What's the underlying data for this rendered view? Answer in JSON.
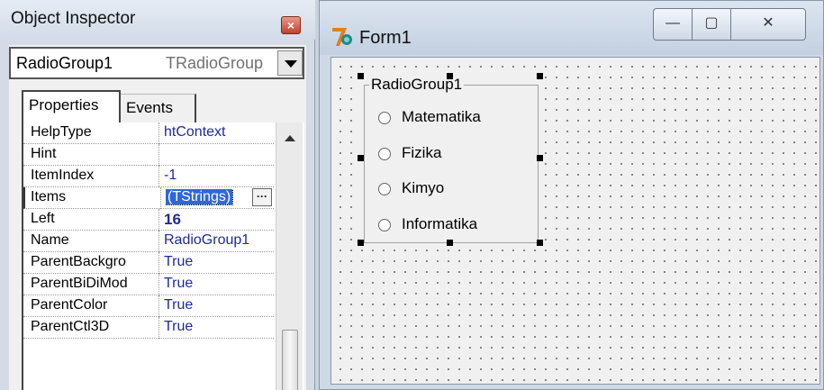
{
  "inspector": {
    "title": "Object Inspector",
    "close_glyph": "×",
    "selected_component": "RadioGroup1",
    "selected_type": "TRadioGroup",
    "tabs": {
      "properties": "Properties",
      "events": "Events"
    },
    "properties": [
      {
        "name": "HelpType",
        "value": "htContext"
      },
      {
        "name": "Hint",
        "value": ""
      },
      {
        "name": "ItemIndex",
        "value": "-1"
      },
      {
        "name": "Items",
        "value": "(TStrings)"
      },
      {
        "name": "Left",
        "value": "16"
      },
      {
        "name": "Name",
        "value": "RadioGroup1"
      },
      {
        "name": "ParentBackgro",
        "value": "True"
      },
      {
        "name": "ParentBiDiMod",
        "value": "True"
      },
      {
        "name": "ParentColor",
        "value": "True"
      },
      {
        "name": "ParentCtl3D",
        "value": "True"
      }
    ],
    "ellipsis_label": "···"
  },
  "form": {
    "title": "Form1",
    "radiogroup": {
      "caption": "RadioGroup1",
      "items": [
        "Matematika",
        "Fizika",
        "Kimyo",
        "Informatika"
      ]
    },
    "caption_buttons": {
      "minimize": "—",
      "maximize": "▢",
      "close": "✕"
    }
  },
  "colors": {
    "value_text": "#1d2a9a",
    "selection": "#2f67d8",
    "close_red": "#c0402c"
  },
  "icons": [
    "close-icon",
    "chevron-down-icon",
    "ellipsis-icon",
    "scroll-up-icon",
    "delphi-logo-icon",
    "minimize-icon",
    "maximize-icon",
    "window-close-icon",
    "radio-icon"
  ]
}
